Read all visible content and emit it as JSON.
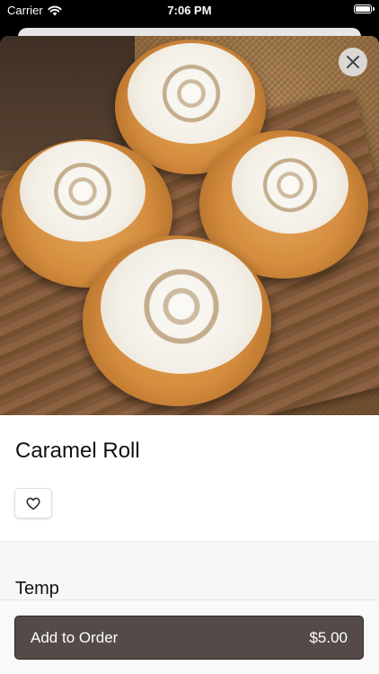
{
  "status_bar": {
    "carrier": "Carrier",
    "time": "7:06 PM"
  },
  "product": {
    "name": "Caramel Roll",
    "image_icon": "cinnamon-rolls-photo"
  },
  "sections": {
    "temp_title": "Temp"
  },
  "order_bar": {
    "add_label": "Add to Order",
    "price": "$5.00",
    "button_color": "#544b48"
  },
  "icons": {
    "close": "close-icon",
    "favorite": "heart-icon",
    "wifi": "wifi-icon",
    "battery": "battery-icon"
  }
}
